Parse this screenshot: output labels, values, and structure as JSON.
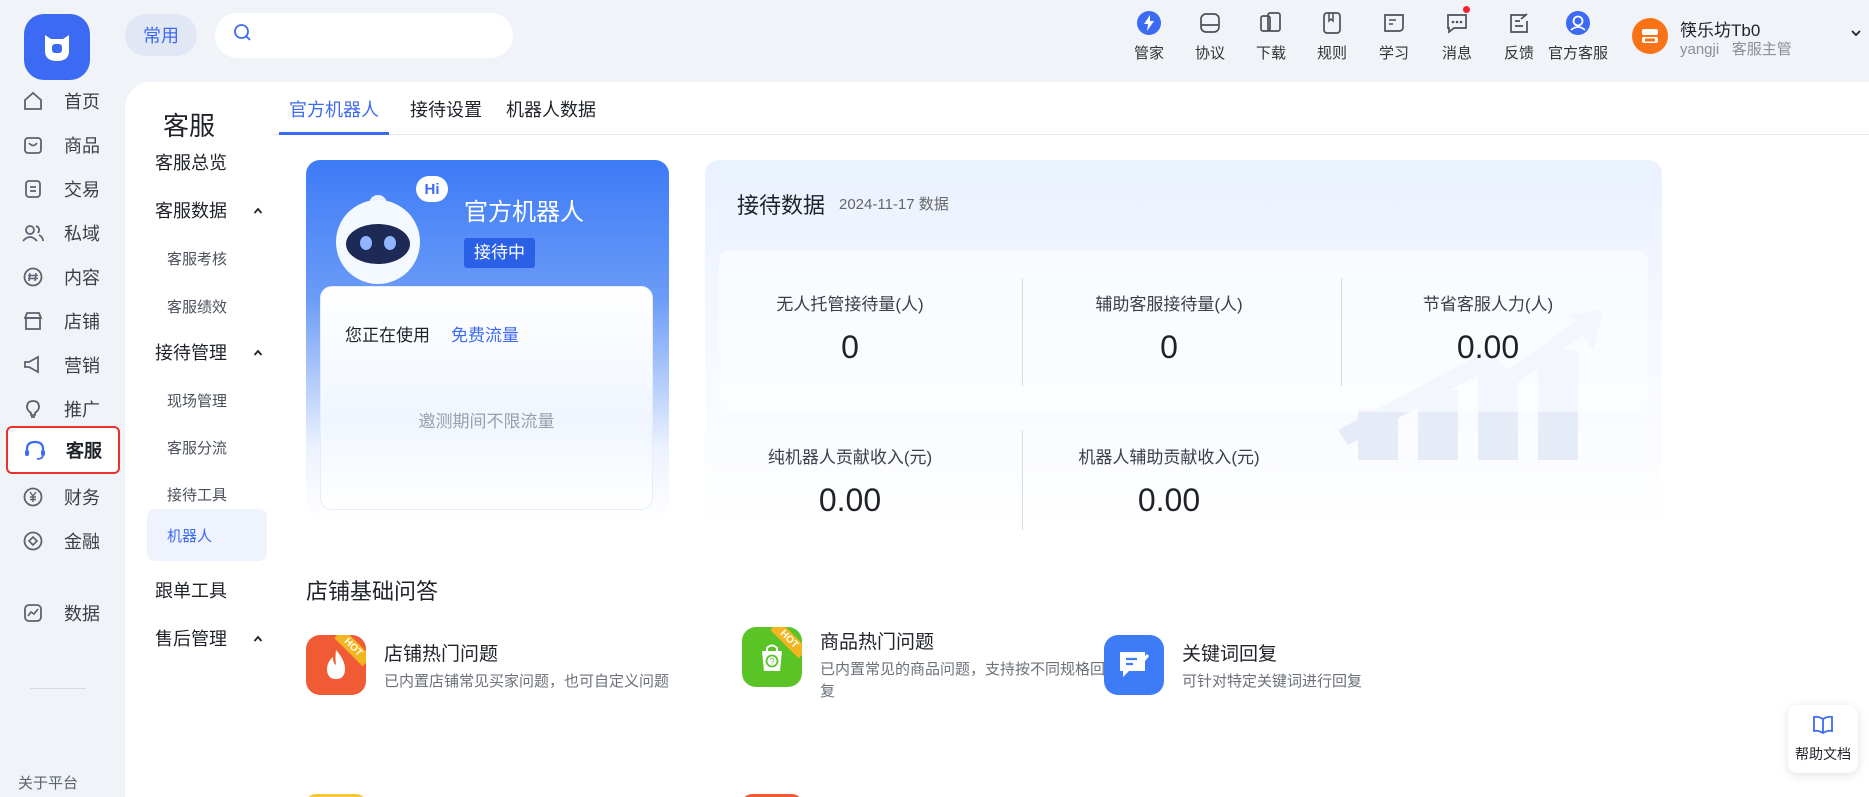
{
  "rail": {
    "items": [
      {
        "label": "首页",
        "icon": "home-icon"
      },
      {
        "label": "商品",
        "icon": "bag-icon"
      },
      {
        "label": "交易",
        "icon": "order-icon"
      },
      {
        "label": "私域",
        "icon": "users-icon"
      },
      {
        "label": "内容",
        "icon": "hash-icon"
      },
      {
        "label": "店铺",
        "icon": "store-icon"
      },
      {
        "label": "营销",
        "icon": "megaphone-icon"
      },
      {
        "label": "推广",
        "icon": "bulb-icon"
      },
      {
        "label": "客服",
        "icon": "headset-icon"
      },
      {
        "label": "财务",
        "icon": "yuan-icon"
      },
      {
        "label": "金融",
        "icon": "finance-icon"
      },
      {
        "label": "数据",
        "icon": "chart-icon"
      }
    ],
    "active": "客服",
    "bottom_text": "关于平台"
  },
  "topbar": {
    "chip_label": "常用",
    "search_placeholder": "",
    "tools": [
      {
        "label": "管家",
        "icon": "lightning-icon"
      },
      {
        "label": "协议",
        "icon": "agreement-icon"
      },
      {
        "label": "下载",
        "icon": "download-icon"
      },
      {
        "label": "规则",
        "icon": "rules-icon"
      },
      {
        "label": "学习",
        "icon": "learn-icon"
      },
      {
        "label": "消息",
        "icon": "message-icon"
      },
      {
        "label": "反馈",
        "icon": "feedback-icon"
      },
      {
        "label": "官方客服",
        "icon": "official-service-icon"
      }
    ],
    "user": {
      "name": "筷乐坊Tb0",
      "account": "yangji",
      "role": "客服主管"
    }
  },
  "subnav": {
    "title": "客服",
    "items": [
      {
        "label": "客服总览",
        "level": 1
      },
      {
        "label": "客服数据",
        "level": 1,
        "expanded": true
      },
      {
        "label": "客服考核",
        "level": 2
      },
      {
        "label": "客服绩效",
        "level": 2
      },
      {
        "label": "接待管理",
        "level": 1,
        "expanded": true
      },
      {
        "label": "现场管理",
        "level": 2
      },
      {
        "label": "客服分流",
        "level": 2
      },
      {
        "label": "接待工具",
        "level": 2
      },
      {
        "label": "机器人",
        "level": 2,
        "selected": true
      },
      {
        "label": "跟单工具",
        "level": 1
      },
      {
        "label": "售后管理",
        "level": 1,
        "expanded": true
      }
    ]
  },
  "tabs": [
    {
      "label": "官方机器人",
      "active": true
    },
    {
      "label": "接待设置",
      "active": false
    },
    {
      "label": "机器人数据",
      "active": false
    }
  ],
  "robot": {
    "bubble": "Hi",
    "name": "官方机器人",
    "status": "接待中",
    "using_label": "您正在使用",
    "flow_link": "免费流量",
    "hint": "邀测期间不限流量"
  },
  "reception": {
    "title": "接待数据",
    "date": "2024-11-17 数据",
    "stats": [
      {
        "label": "无人托管接待量(人)",
        "value": "0"
      },
      {
        "label": "辅助客服接待量(人)",
        "value": "0"
      },
      {
        "label": "节省客服人力(人)",
        "value": "0.00"
      },
      {
        "label": "纯机器人贡献收入(元)",
        "value": "0.00"
      },
      {
        "label": "机器人辅助贡献收入(元)",
        "value": "0.00"
      }
    ]
  },
  "faq": {
    "title": "店铺基础问答",
    "items": [
      {
        "title": "店铺热门问题",
        "desc": "已内置店铺常见买家问题，也可自定义问题",
        "badge": "HOT",
        "color": "#f05a35"
      },
      {
        "title": "商品热门问题",
        "desc": "已内置常见的商品问题，支持按不同规格回复",
        "badge": "HOT",
        "color": "#5ac326"
      },
      {
        "title": "关键词回复",
        "desc": "可针对特定关键词进行回复",
        "badge": "",
        "color": "#3d7bf7"
      }
    ]
  },
  "help": {
    "label": "帮助文档"
  },
  "colors": {
    "accent": "#3d6af2",
    "highlight": "#e8322b"
  }
}
